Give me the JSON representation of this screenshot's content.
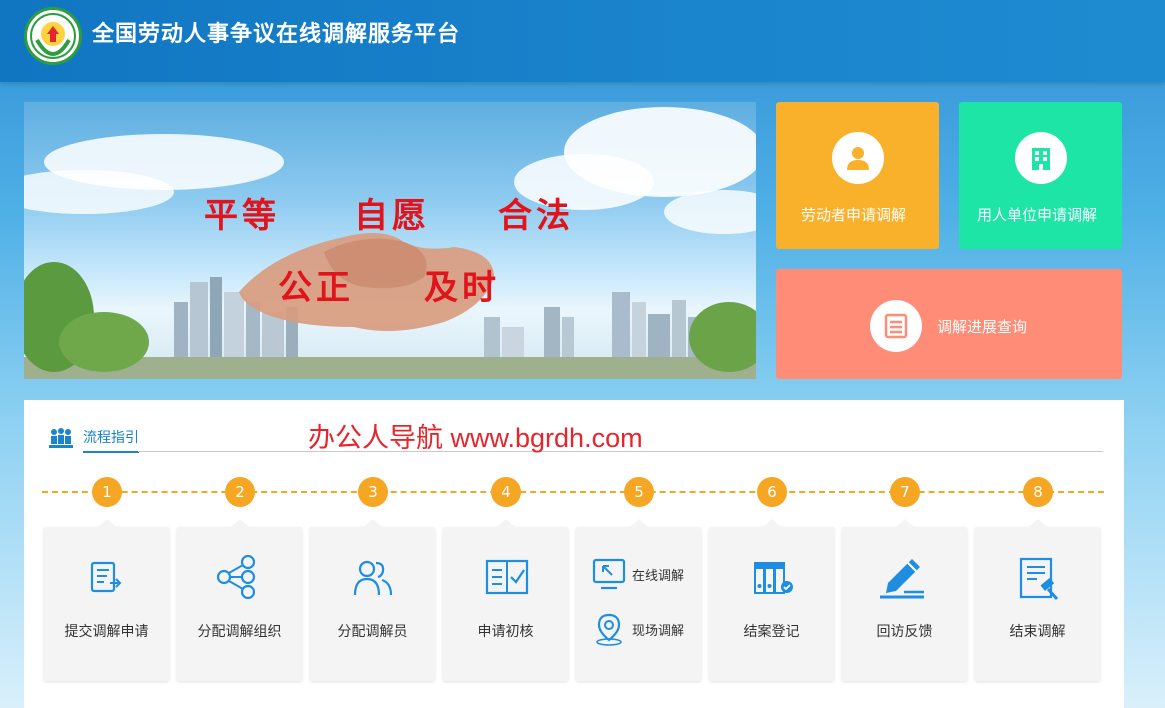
{
  "header": {
    "title": "全国劳动人事争议在线调解服务平台",
    "logo_icon": "emblem-icon"
  },
  "hero": {
    "slogans": [
      "平等",
      "自愿",
      "合法",
      "公正",
      "及时"
    ]
  },
  "actions": {
    "worker": {
      "label": "劳动者申请调解",
      "icon": "person-icon",
      "color": "#f9b12c"
    },
    "employer": {
      "label": "用人单位申请调解",
      "icon": "building-icon",
      "color": "#1de5a6"
    },
    "progress": {
      "label": "调解进展查询",
      "icon": "document-icon",
      "color": "#ff8c76"
    }
  },
  "guide": {
    "title": "流程指引",
    "watermark": "办公人导航 www.bgrdh.com",
    "steps": [
      {
        "num": "1",
        "label": "提交调解申请",
        "icon": "submit-form-icon"
      },
      {
        "num": "2",
        "label": "分配调解组织",
        "icon": "network-icon"
      },
      {
        "num": "3",
        "label": "分配调解员",
        "icon": "people-icon"
      },
      {
        "num": "4",
        "label": "申请初核",
        "icon": "checklist-icon"
      },
      {
        "num": "5",
        "label": "",
        "icon": "",
        "options": [
          {
            "label": "在线调解",
            "icon": "online-screen-icon"
          },
          {
            "label": "现场调解",
            "icon": "location-pin-icon"
          }
        ]
      },
      {
        "num": "6",
        "label": "结案登记",
        "icon": "binders-icon"
      },
      {
        "num": "7",
        "label": "回访反馈",
        "icon": "pen-icon"
      },
      {
        "num": "8",
        "label": "结束调解",
        "icon": "gavel-document-icon"
      }
    ]
  }
}
